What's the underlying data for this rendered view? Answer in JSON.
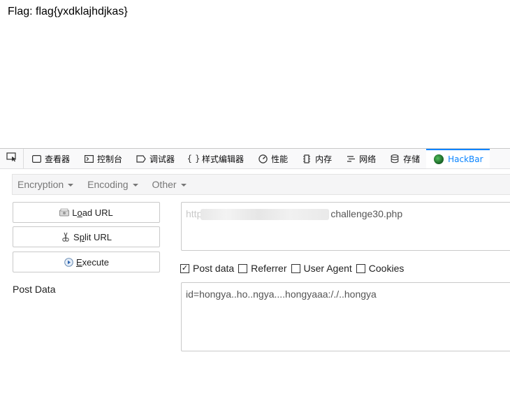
{
  "page": {
    "flag_line": "Flag: flag{yxdklajhdjkas}"
  },
  "devtools": {
    "tabs": [
      {
        "label": "查看器",
        "icon": "inspector-icon"
      },
      {
        "label": "控制台",
        "icon": "console-icon"
      },
      {
        "label": "调试器",
        "icon": "debugger-icon"
      },
      {
        "label": "样式编辑器",
        "icon": "style-editor-icon"
      },
      {
        "label": "性能",
        "icon": "performance-icon"
      },
      {
        "label": "内存",
        "icon": "memory-icon"
      },
      {
        "label": "网络",
        "icon": "network-icon"
      },
      {
        "label": "存储",
        "icon": "storage-icon"
      },
      {
        "label": "HackBar",
        "icon": "hackbar-icon"
      }
    ],
    "active_tab": "HackBar",
    "accent": "#0a84ff"
  },
  "hackbar": {
    "menus": [
      "Encryption",
      "Encoding",
      "Other"
    ],
    "buttons": {
      "load": {
        "pre": "L",
        "mn": "o",
        "post": "ad URL"
      },
      "split": {
        "pre": "S",
        "mn": "p",
        "post": "lit URL"
      },
      "execute": {
        "pre": "",
        "mn": "E",
        "post": "xecute"
      }
    },
    "post_data_label": "Post Data",
    "url": {
      "prefix": "http",
      "suffix": "challenge30.php"
    },
    "options": [
      {
        "label": "Post data",
        "checked": true
      },
      {
        "label": "Referrer",
        "checked": false
      },
      {
        "label": "User Agent",
        "checked": false
      },
      {
        "label": "Cookies",
        "checked": false
      }
    ],
    "post_body": "id=hongya..ho..ngya....hongyaaa:/./..hongya"
  }
}
